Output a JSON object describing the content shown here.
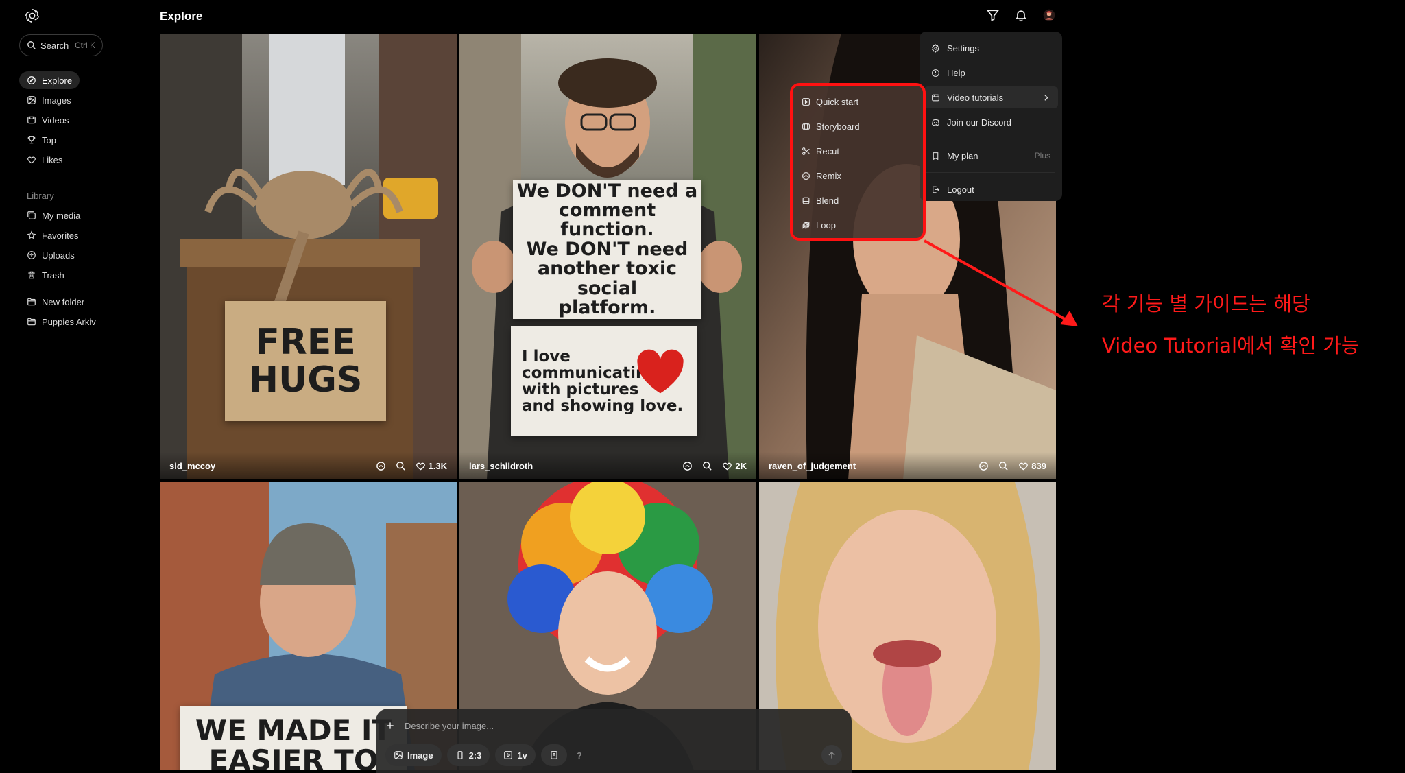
{
  "sidebar": {
    "search": {
      "label": "Search",
      "shortcut": "Ctrl K"
    },
    "nav": [
      {
        "label": "Explore",
        "icon": "compass-icon",
        "active": true
      },
      {
        "label": "Images",
        "icon": "image-icon"
      },
      {
        "label": "Videos",
        "icon": "video-icon"
      },
      {
        "label": "Top",
        "icon": "trophy-icon"
      },
      {
        "label": "Likes",
        "icon": "heart-icon"
      }
    ],
    "library_label": "Library",
    "library": [
      {
        "label": "My media",
        "icon": "media-icon"
      },
      {
        "label": "Favorites",
        "icon": "star-icon"
      },
      {
        "label": "Uploads",
        "icon": "upload-icon"
      },
      {
        "label": "Trash",
        "icon": "trash-icon"
      }
    ],
    "folders": [
      {
        "label": "New folder",
        "icon": "folder-plus-icon"
      },
      {
        "label": "Puppies Arkiv",
        "icon": "folder-icon"
      }
    ]
  },
  "header": {
    "title": "Explore"
  },
  "cards": [
    {
      "user": "sid_mccoy",
      "likes": "1.3K",
      "sign": "FREE\nHUGS"
    },
    {
      "user": "lars_schildroth",
      "likes": "2K",
      "sign_top": "We DON'T need a\ncomment function.\nWe DON'T need\nanother toxic social\nplatform.",
      "sign_bottom": "I love\ncommunicating\nwith pictures\nand showing love."
    },
    {
      "user": "raven_of_judgement",
      "likes": "839"
    },
    {
      "sign": "WE MADE IT\nEASIER TO"
    },
    {},
    {}
  ],
  "menu": {
    "items": [
      {
        "label": "Settings",
        "icon": "gear-icon"
      },
      {
        "label": "Help",
        "icon": "help-icon"
      },
      {
        "label": "Video tutorials",
        "icon": "video-icon"
      },
      {
        "label": "Join our Discord",
        "icon": "discord-icon"
      },
      {
        "label": "My plan",
        "icon": "plan-icon",
        "badge": "Plus"
      },
      {
        "label": "Logout",
        "icon": "logout-icon"
      }
    ]
  },
  "submenu": {
    "items": [
      {
        "label": "Quick start",
        "icon": "play-icon"
      },
      {
        "label": "Storyboard",
        "icon": "storyboard-icon"
      },
      {
        "label": "Recut",
        "icon": "scissors-icon"
      },
      {
        "label": "Remix",
        "icon": "remix-icon"
      },
      {
        "label": "Blend",
        "icon": "blend-icon"
      },
      {
        "label": "Loop",
        "icon": "loop-icon"
      }
    ]
  },
  "annotation": {
    "line1": "각 기능 별 가이드는 해당",
    "line2": "Video Tutorial에서 확인 가능",
    "color": "#ff1a1a"
  },
  "composer": {
    "placeholder": "Describe your image...",
    "type_label": "Image",
    "ratio_label": "2:3",
    "variations_label": "1v",
    "help_label": "?"
  }
}
